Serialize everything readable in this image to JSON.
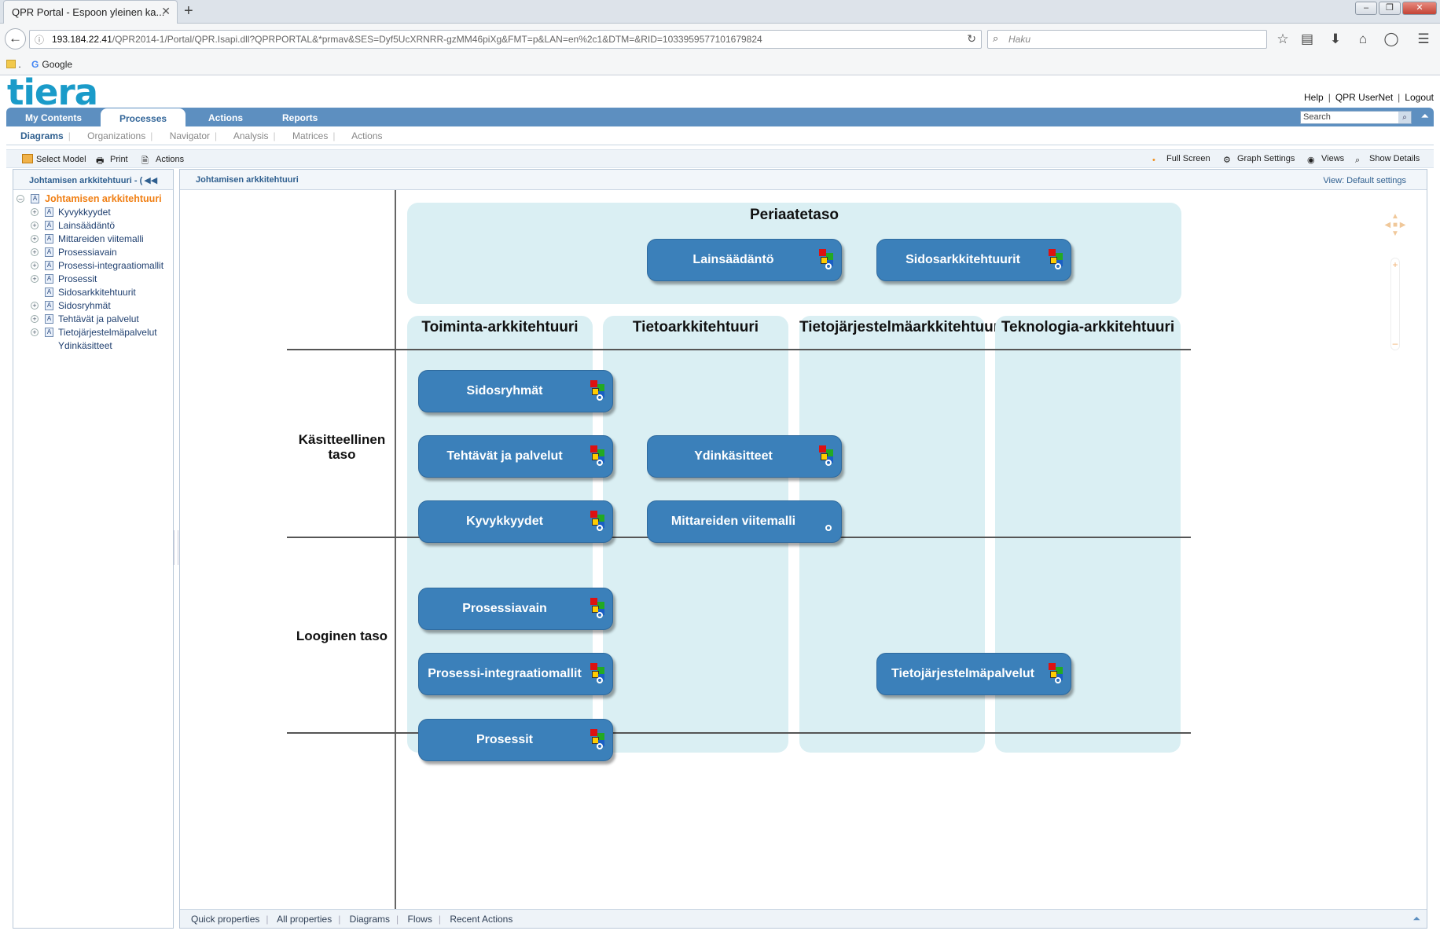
{
  "browser": {
    "tab_title": "QPR Portal - Espoon yleinen ka...",
    "url_host": "193.184.22.41",
    "url_path": "/QPR2014-1/Portal/QPR.Isapi.dll?QPRPORTAL&*prmav&SES=Dyf5UcXRNRR-gzMM46piXg&FMT=p&LAN=en%2c1&DTM=&RID=1033959577101679824",
    "search_placeholder": "Haku",
    "bookmarks": [
      ".",
      "Google"
    ]
  },
  "header": {
    "logo": "tiera",
    "links": [
      "Help",
      "QPR UserNet",
      "Logout"
    ]
  },
  "mainnav": {
    "tabs": [
      "My Contents",
      "Processes",
      "Actions",
      "Reports"
    ],
    "active": "Processes",
    "search_placeholder": "Search"
  },
  "subnav": {
    "items": [
      "Diagrams",
      "Organizations",
      "Navigator",
      "Analysis",
      "Matrices",
      "Actions"
    ],
    "active": "Diagrams"
  },
  "toolbar": {
    "left": [
      "Select Model",
      "Print",
      "Actions"
    ],
    "right": [
      "Full Screen",
      "Graph Settings",
      "Views",
      "Show Details"
    ]
  },
  "leftpanel": {
    "title": "Johtamisen arkkitehtuuri - (",
    "collapse_glyph": "◀◀",
    "root": "Johtamisen arkkitehtuuri",
    "children": [
      {
        "label": "Kyvykkyydet",
        "expandable": true
      },
      {
        "label": "Lainsäädäntö",
        "expandable": true
      },
      {
        "label": "Mittareiden viitemalli",
        "expandable": true
      },
      {
        "label": "Prosessiavain",
        "expandable": true
      },
      {
        "label": "Prosessi-integraatiomallit",
        "expandable": true
      },
      {
        "label": "Prosessit",
        "expandable": true
      },
      {
        "label": "Sidosarkkitehtuurit",
        "expandable": false
      },
      {
        "label": "Sidosryhmät",
        "expandable": true
      },
      {
        "label": "Tehtävät ja palvelut",
        "expandable": true
      },
      {
        "label": "Tietojärjestelmäpalvelut",
        "expandable": true
      },
      {
        "label": "Ydinkäsitteet",
        "expandable": false
      }
    ]
  },
  "diagram": {
    "title": "Johtamisen arkkitehtuuri",
    "view_label": "View: Default settings",
    "top_region": "Periaatetaso",
    "columns": [
      "Toiminta-arkkitehtuuri",
      "Tietoarkkitehtuuri",
      "Tietojärjestelmäarkkitehtuuri",
      "Teknologia-arkkitehtuuri"
    ],
    "row_labels": [
      "Käsitteellinen taso",
      "Looginen taso"
    ],
    "nodes": {
      "lainsaadanto": "Lainsäädäntö",
      "sidosarkkitehtuurit": "Sidosarkkitehtuurit",
      "sidosryhmat": "Sidosryhmät",
      "tehtavat": "Tehtävät ja palvelut",
      "kyvykkyydet": "Kyvykkyydet",
      "ydinkasitteet": "Ydinkäsitteet",
      "mittareiden": "Mittareiden viitemalli",
      "prosessiavain": "Prosessiavain",
      "prosessi_integraatio": "Prosessi-integraatiomallit",
      "prosessit": "Prosessit",
      "tietojarjestelmapalvelut": "Tietojärjestelmäpalvelut"
    }
  },
  "footer": {
    "tabs": [
      "Quick properties",
      "All properties",
      "Diagrams",
      "Flows",
      "Recent Actions"
    ]
  }
}
